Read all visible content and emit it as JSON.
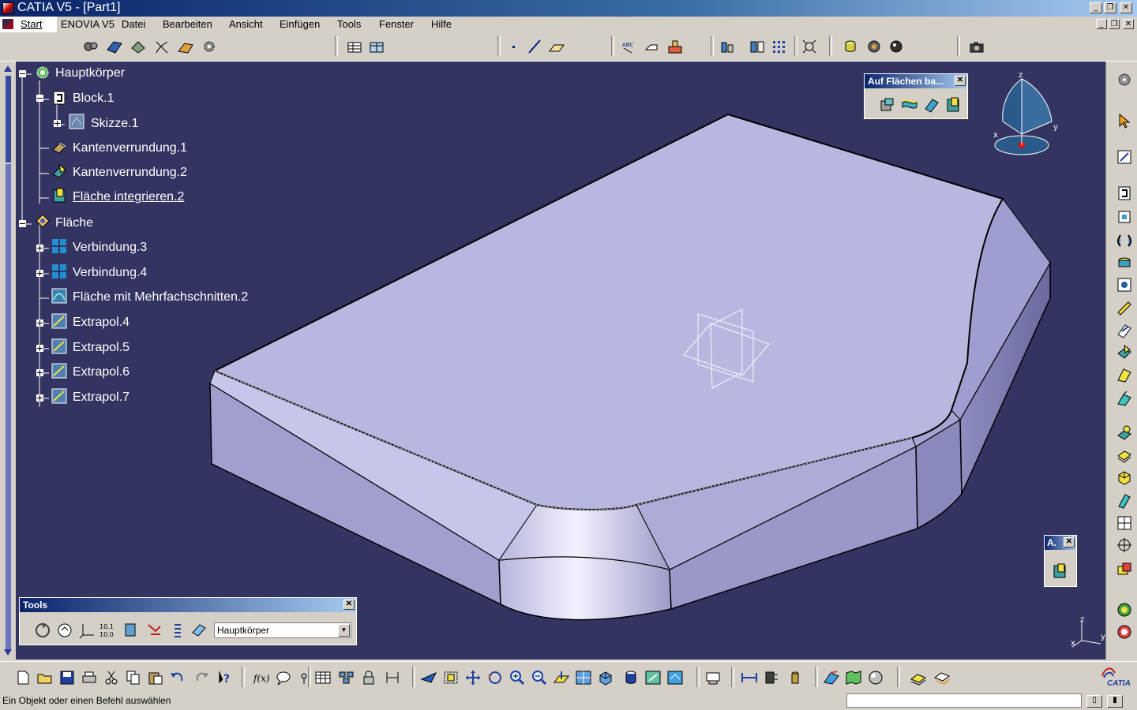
{
  "window": {
    "title": "CATIA V5 - [Part1]"
  },
  "menubar": {
    "items": [
      "Start",
      "ENOVIA V5",
      "Datei",
      "Bearbeiten",
      "Ansicht",
      "Einfügen",
      "Tools",
      "Fenster",
      "Hilfe"
    ]
  },
  "tree": {
    "nodes": [
      {
        "label": "Hauptkörper",
        "icon": "body-gear-icon"
      },
      {
        "label": "Block.1",
        "icon": "pad-icon"
      },
      {
        "label": "Skizze.1",
        "icon": "sketch-icon"
      },
      {
        "label": "Kantenverrundung.1",
        "icon": "edge-fillet-icon"
      },
      {
        "label": "Kantenverrundung.2",
        "icon": "edge-fillet-icon"
      },
      {
        "label": "Fläche integrieren.2",
        "icon": "close-surface-icon"
      },
      {
        "label": "Fläche",
        "icon": "geometrical-set-icon"
      },
      {
        "label": "Verbindung.3",
        "icon": "join-icon"
      },
      {
        "label": "Verbindung.4",
        "icon": "join-icon"
      },
      {
        "label": "Fläche mit Mehrfachschnitten.2",
        "icon": "multi-section-surface-icon"
      },
      {
        "label": "Extrapol.4",
        "icon": "extrapolate-icon"
      },
      {
        "label": "Extrapol.5",
        "icon": "extrapolate-icon"
      },
      {
        "label": "Extrapol.6",
        "icon": "extrapolate-icon"
      },
      {
        "label": "Extrapol.7",
        "icon": "extrapolate-icon"
      }
    ]
  },
  "panels": {
    "faces": {
      "title": "Auf Flächen ba..."
    },
    "a": {
      "title": "A."
    },
    "tools": {
      "title": "Tools",
      "combo_value": "Hauptkörper"
    }
  },
  "compass": {
    "x": "x",
    "y": "y",
    "z": "z"
  },
  "axis": {
    "x": "x",
    "y": "y",
    "z": "z"
  },
  "status": {
    "text": "Ein Objekt oder einen Befehl auswählen"
  },
  "logo": {
    "text": "CATIA"
  },
  "colors": {
    "background": "#343463",
    "part": "#b7b6df",
    "ui": "#d4d0c8"
  }
}
